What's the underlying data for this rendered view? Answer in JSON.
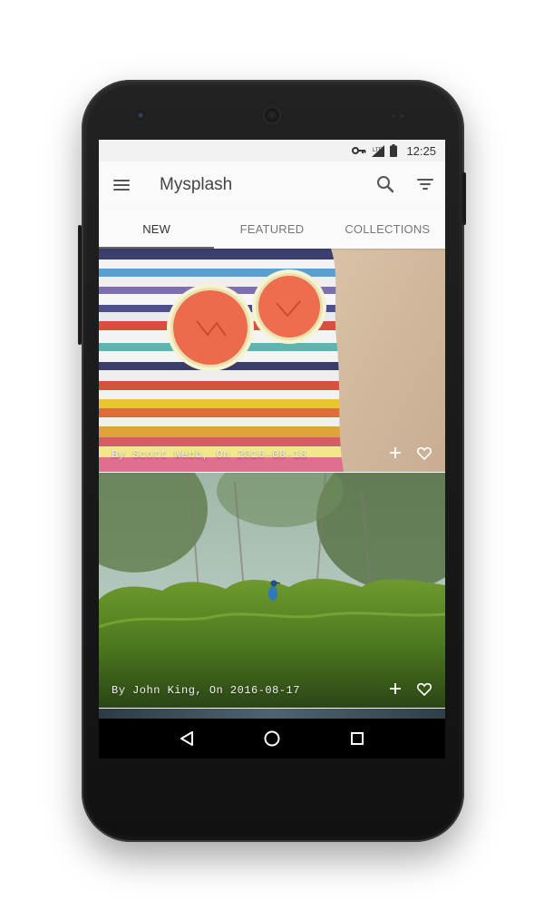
{
  "status_bar": {
    "time": "12:25",
    "icons": [
      "vpn-key-icon",
      "signal-icon",
      "battery-icon"
    ]
  },
  "app_bar": {
    "title": "Mysplash",
    "icons": [
      "menu-icon",
      "search-icon",
      "filter-icon"
    ]
  },
  "tabs": [
    {
      "label": "NEW",
      "active": true
    },
    {
      "label": "FEATURED",
      "active": false
    },
    {
      "label": "COLLECTIONS",
      "active": false
    }
  ],
  "feed": {
    "items": [
      {
        "caption": "By Scott Webb, On 2016-08-18",
        "actions": [
          "add-icon",
          "heart-icon"
        ]
      },
      {
        "caption": "By John King, On 2016-08-17",
        "actions": [
          "add-icon",
          "heart-icon"
        ]
      }
    ]
  },
  "nav_bar": {
    "icons": [
      "back-triangle-icon",
      "home-circle-icon",
      "recents-square-icon"
    ]
  },
  "colors": {
    "app_background": "#fafafa",
    "status_bar": "#f2f2f2",
    "tab_indicator": "#666666",
    "nav_bar": "#000000"
  }
}
